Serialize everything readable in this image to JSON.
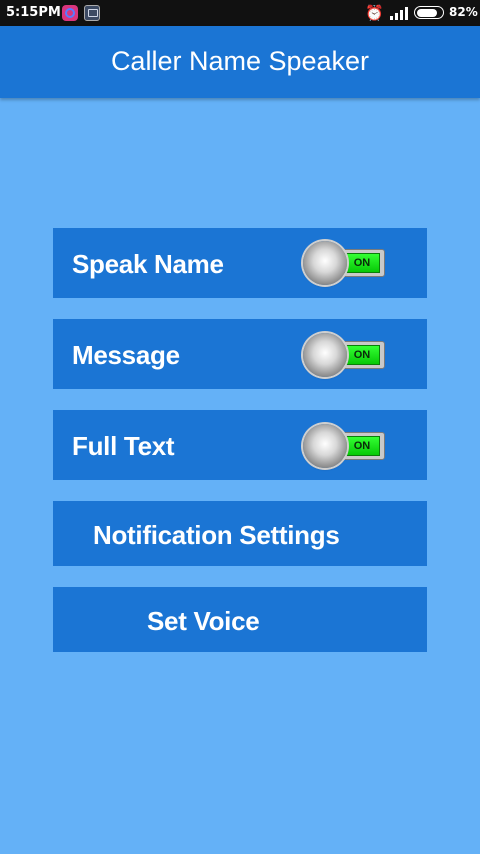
{
  "status_bar": {
    "time": "5:15PM",
    "battery_percent": "82%",
    "battery_level": 0.82,
    "icons": [
      "o-app-icon",
      "photo-icon",
      "alarm-off-icon",
      "signal-icon",
      "battery-icon"
    ]
  },
  "app_bar": {
    "title": "Caller Name Speaker"
  },
  "settings": {
    "rows": [
      {
        "label": "Speak Name",
        "toggle_text": "ON",
        "toggle_state": true
      },
      {
        "label": "Message",
        "toggle_text": "ON",
        "toggle_state": true
      },
      {
        "label": "Full Text",
        "toggle_text": "ON",
        "toggle_state": true
      }
    ],
    "notification_button": "Notification Settings",
    "voice_button": "Set Voice"
  },
  "colors": {
    "background": "#64b1f7",
    "app_bar": "#1b75d4",
    "row": "#1b75d4",
    "toggle_on": "#1ee61e",
    "status_bar": "#111111"
  }
}
